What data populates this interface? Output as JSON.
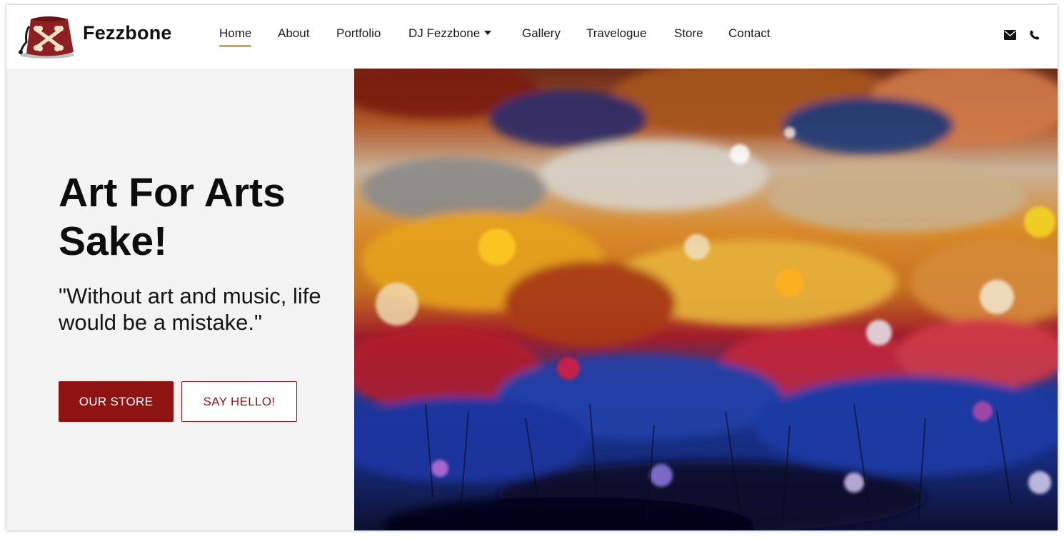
{
  "header": {
    "brand": "Fezzbone",
    "nav": [
      {
        "label": "Home"
      },
      {
        "label": "About"
      },
      {
        "label": "Portfolio"
      },
      {
        "label": "DJ Fezzbone"
      },
      {
        "label": "Gallery"
      },
      {
        "label": "Travelogue"
      },
      {
        "label": "Store"
      },
      {
        "label": "Contact"
      }
    ],
    "active_nav": "Home",
    "icons": [
      "envelope-icon",
      "phone-icon"
    ],
    "accent_color": "#d4a055"
  },
  "hero": {
    "title": "Art For Arts Sake!",
    "quote": "\"Without art and music, life would be a mistake.\"",
    "primary_button": "OUR STORE",
    "secondary_button": "SAY HELLO!",
    "brand_color": "#8e1313",
    "panel_color": "#f3f3f3"
  }
}
